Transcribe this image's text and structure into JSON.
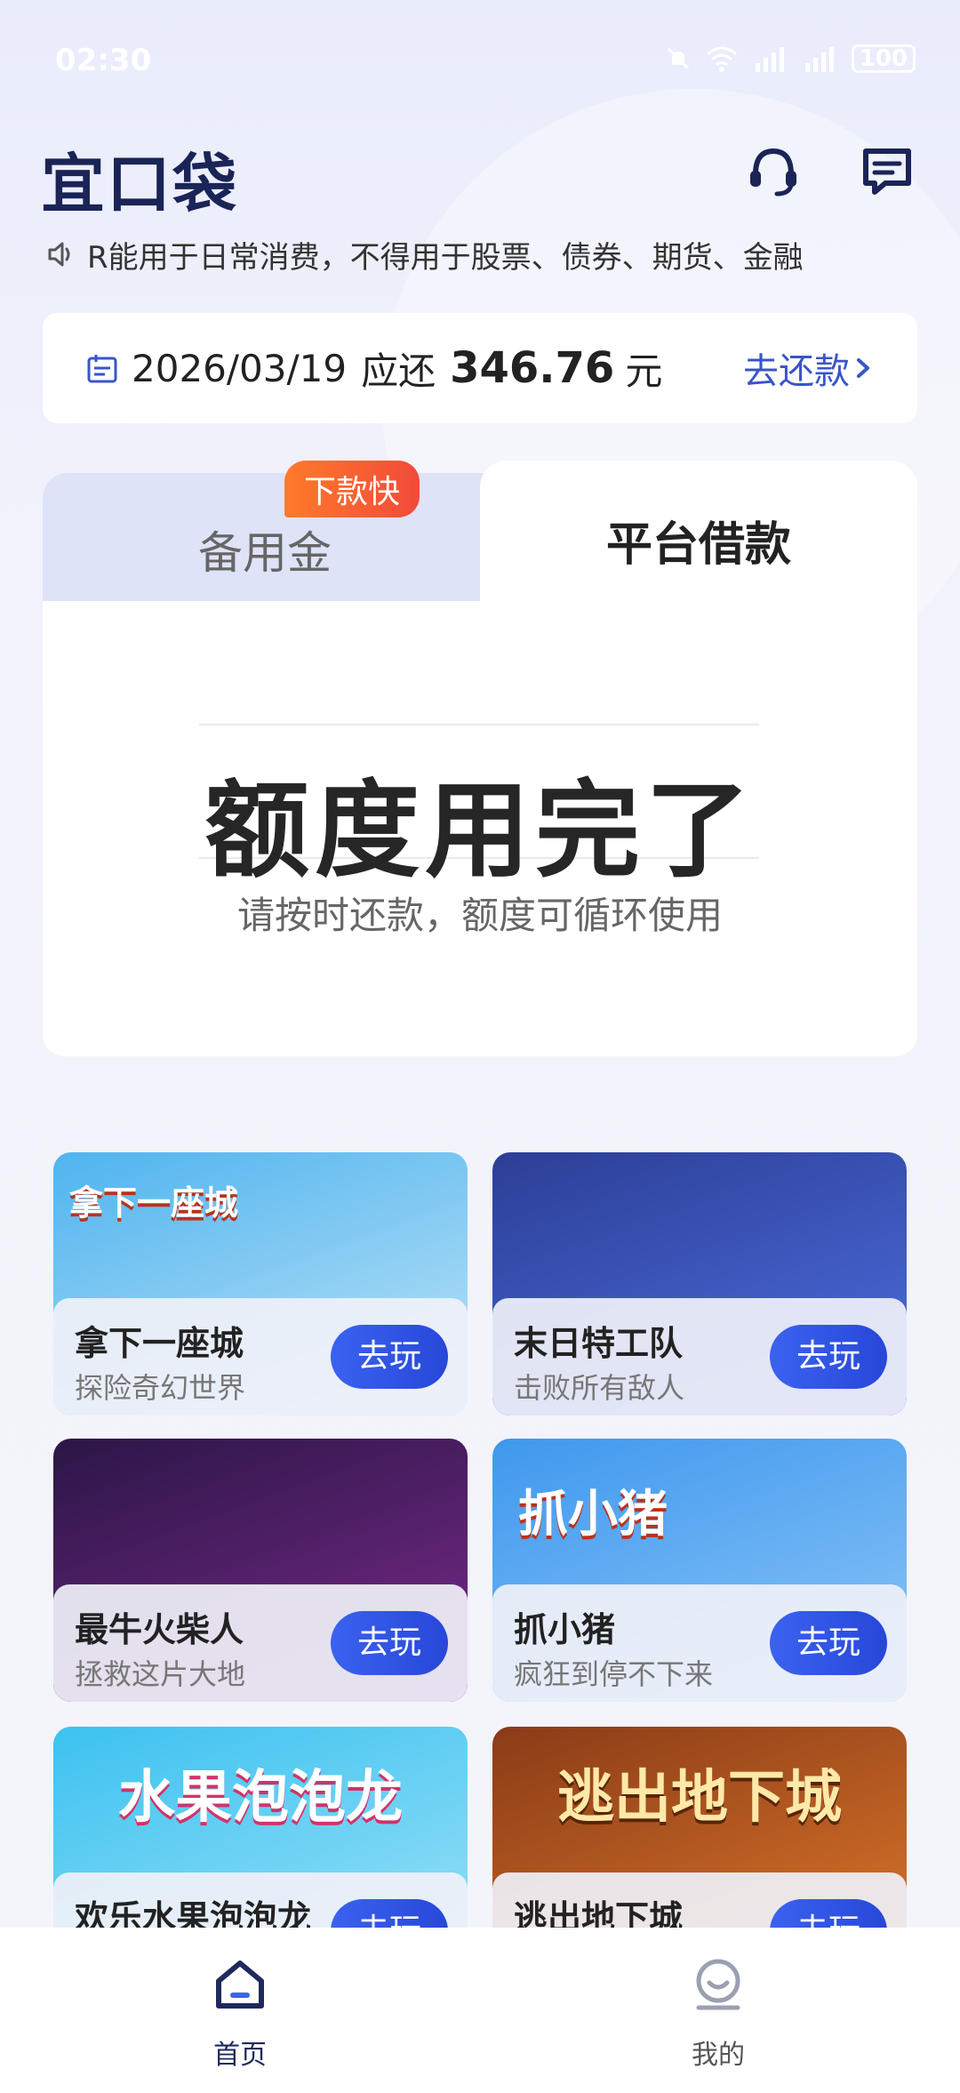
{
  "status_bar": {
    "time": "02:30",
    "battery": "100",
    "icons": [
      "mute-icon",
      "wifi-icon",
      "signal-icon",
      "signal-icon",
      "battery-icon"
    ]
  },
  "header": {
    "logo": "宜口袋",
    "support_icon": "headset-icon",
    "message_icon": "message-icon"
  },
  "notice": {
    "icon": "speaker-icon",
    "text": "R能用于日常消费，不得用于股票、债券、期货、金融"
  },
  "repayment": {
    "date": "2026/03/19",
    "due_label": "应还",
    "amount": "346.76",
    "unit": "元",
    "action_label": "去还款"
  },
  "tabs": {
    "inactive_label": "备用金",
    "badge": "下款快",
    "active_label": "平台借款"
  },
  "quota": {
    "title": "额度用完了",
    "subtitle": "请按时还款，额度可循环使用"
  },
  "games": [
    {
      "name": "拿下一座城",
      "desc": "探险奇幻世界",
      "art_label": "拿下一座城",
      "colors": [
        "#4fb4ef",
        "#bfe4f7"
      ],
      "play": "去玩"
    },
    {
      "name": "末日特工队",
      "desc": "击败所有敌人",
      "art_label": "",
      "colors": [
        "#2c3f96",
        "#4d6ee0"
      ],
      "play": "去玩"
    },
    {
      "name": "最牛火柴人",
      "desc": "拯救这片大地",
      "art_label": "",
      "colors": [
        "#2b1646",
        "#7a2a8c"
      ],
      "play": "去玩"
    },
    {
      "name": "抓小猪",
      "desc": "疯狂到停不下来",
      "art_label": "抓小猪",
      "colors": [
        "#3f98ee",
        "#8cc6f7"
      ],
      "play": "去玩"
    },
    {
      "name": "欢乐水果泡泡龙",
      "desc": "",
      "art_label": "水果泡泡龙",
      "colors": [
        "#3cc2f0",
        "#9ee2f7"
      ],
      "play": "去玩"
    },
    {
      "name": "逃出地下城",
      "desc": "",
      "art_label": "逃出地下城",
      "colors": [
        "#8a3b17",
        "#e07a2b"
      ],
      "play": "去玩"
    }
  ],
  "bottom_nav": [
    {
      "label": "首页",
      "icon": "home-icon",
      "active": true
    },
    {
      "label": "我的",
      "icon": "profile-icon",
      "active": false
    }
  ]
}
